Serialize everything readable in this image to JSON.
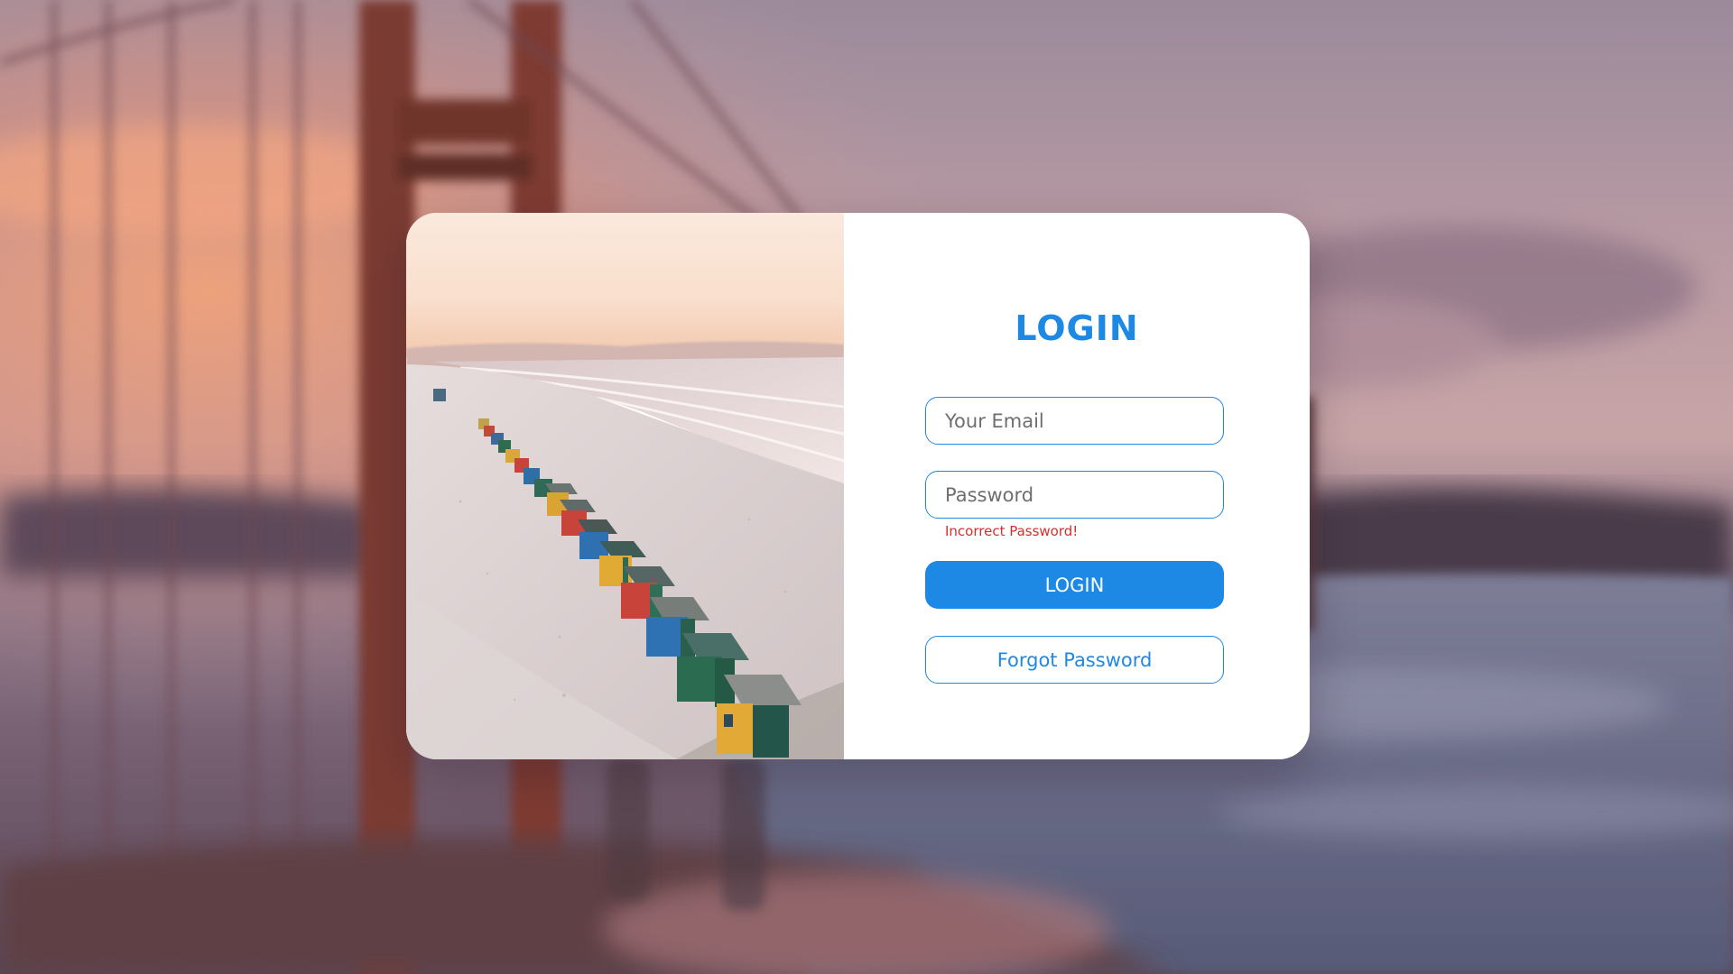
{
  "login": {
    "title": "LOGIN",
    "email_placeholder": "Your Email",
    "password_placeholder": "Password",
    "error_message": "Incorrect Password!",
    "login_button_label": "LOGIN",
    "forgot_button_label": "Forgot Password"
  },
  "colors": {
    "accent": "#1e88e5",
    "error": "#d32f2f",
    "card_background": "#ffffff"
  }
}
